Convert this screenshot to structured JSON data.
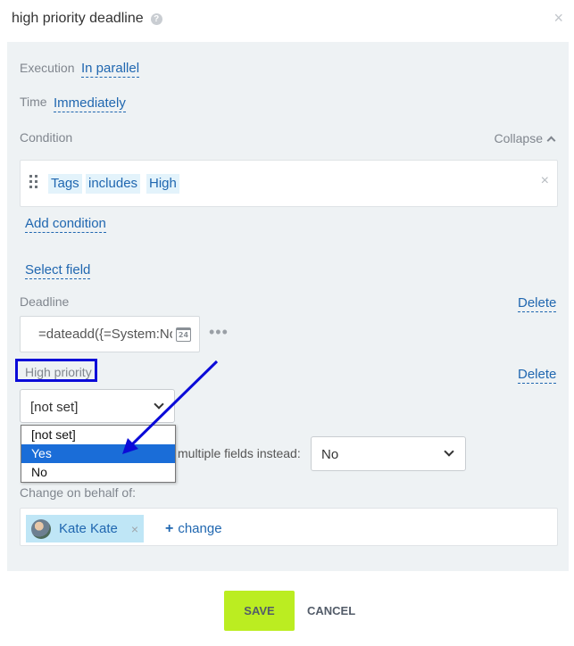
{
  "dialog": {
    "title": "high priority deadline",
    "help_icon": "?",
    "close_icon": "×"
  },
  "execution": {
    "label": "Execution",
    "value": "In parallel"
  },
  "time": {
    "label": "Time",
    "value": "Immediately"
  },
  "condition": {
    "label": "Condition",
    "collapse_label": "Collapse",
    "tags": [
      "Tags",
      "includes",
      "High"
    ],
    "remove_icon": "×",
    "add_condition": "Add condition"
  },
  "select_field": "Select field",
  "deadline": {
    "label": "Deadline",
    "delete_label": "Delete",
    "value": "=dateadd({=System:Now}",
    "calendar_day": "24",
    "more_icon": "•••"
  },
  "high_priority": {
    "label": "High priority",
    "delete_label": "Delete",
    "selected": "[not set]",
    "options": [
      "[not set]",
      "Yes",
      "No"
    ],
    "highlighted_option": "Yes"
  },
  "multiple_fields": {
    "label_visible": "multiple fields instead:",
    "value": "No"
  },
  "behalf": {
    "label": "Change on behalf of:",
    "user_name": "Kate Kate",
    "remove_icon": "×",
    "change_plus": "+",
    "change_label": "change"
  },
  "footer": {
    "save_label": "SAVE",
    "cancel_label": "CANCEL"
  },
  "colors": {
    "link": "#2067b0",
    "panel_bg": "#eef2f4",
    "save_bg": "#bbed21",
    "annotation_blue": "#0b0bd8",
    "dropdown_selected": "#1a6dd8"
  }
}
